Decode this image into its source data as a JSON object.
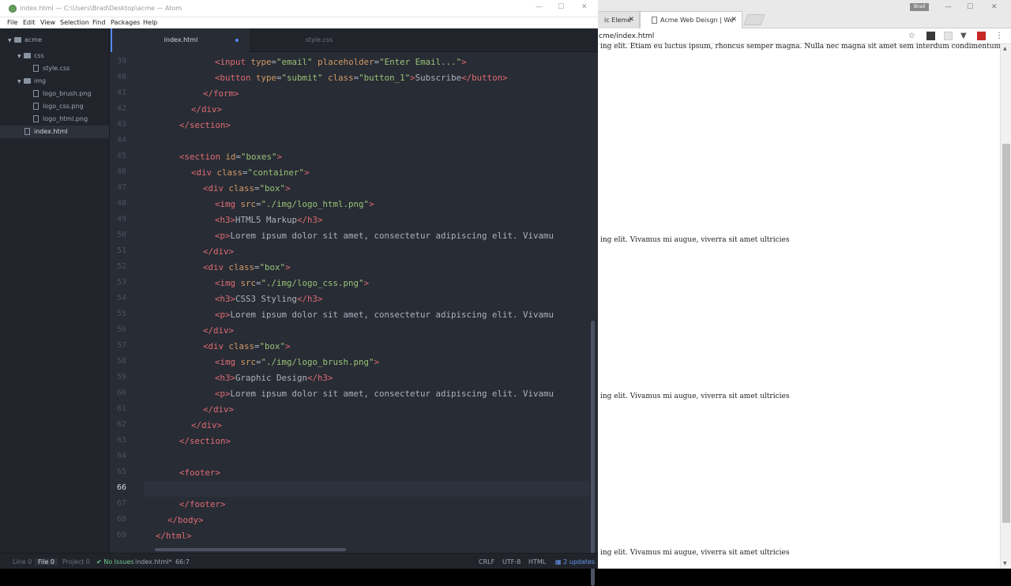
{
  "atom": {
    "window_title": "index.html — C:\\Users\\Brad\\Desktop\\acme — Atom",
    "menu": [
      "File",
      "Edit",
      "View",
      "Selection",
      "Find",
      "Packages",
      "Help"
    ],
    "tree": {
      "root": "acme",
      "css_folder": "css",
      "css_files": [
        "style.css"
      ],
      "img_folder": "img",
      "img_files": [
        "logo_brush.png",
        "logo_css.png",
        "logo_html.png"
      ],
      "root_file": "index.html"
    },
    "tabs": [
      {
        "label": "index.html",
        "modified": true
      },
      {
        "label": "style.css",
        "modified": false
      }
    ],
    "cursor_line": 66,
    "lines": [
      {
        "n": 39,
        "i": 6,
        "c": [
          [
            "t",
            "<input"
          ],
          [
            "a",
            " type"
          ],
          [
            "p",
            "="
          ],
          [
            "s",
            "\"email\""
          ],
          [
            "a",
            " placeholder"
          ],
          [
            "p",
            "="
          ],
          [
            "s",
            "\"Enter Email...\""
          ],
          [
            "t",
            ">"
          ]
        ]
      },
      {
        "n": 40,
        "i": 6,
        "c": [
          [
            "t",
            "<button"
          ],
          [
            "a",
            " type"
          ],
          [
            "p",
            "="
          ],
          [
            "s",
            "\"submit\""
          ],
          [
            "a",
            " class"
          ],
          [
            "p",
            "="
          ],
          [
            "s",
            "\"button_1\""
          ],
          [
            "t",
            ">"
          ],
          [
            "x",
            "Subscribe"
          ],
          [
            "t",
            "</button>"
          ]
        ]
      },
      {
        "n": 41,
        "i": 5,
        "c": [
          [
            "t",
            "</form>"
          ]
        ]
      },
      {
        "n": 42,
        "i": 4,
        "c": [
          [
            "t",
            "</div>"
          ]
        ]
      },
      {
        "n": 43,
        "i": 3,
        "c": [
          [
            "t",
            "</section>"
          ]
        ]
      },
      {
        "n": 44,
        "i": 0,
        "c": []
      },
      {
        "n": 45,
        "i": 3,
        "c": [
          [
            "t",
            "<section"
          ],
          [
            "a",
            " id"
          ],
          [
            "p",
            "="
          ],
          [
            "s",
            "\"boxes\""
          ],
          [
            "t",
            ">"
          ]
        ]
      },
      {
        "n": 46,
        "i": 4,
        "c": [
          [
            "t",
            "<div"
          ],
          [
            "a",
            " class"
          ],
          [
            "p",
            "="
          ],
          [
            "s",
            "\"container\""
          ],
          [
            "t",
            ">"
          ]
        ]
      },
      {
        "n": 47,
        "i": 5,
        "c": [
          [
            "t",
            "<div"
          ],
          [
            "a",
            " class"
          ],
          [
            "p",
            "="
          ],
          [
            "s",
            "\"box\""
          ],
          [
            "t",
            ">"
          ]
        ]
      },
      {
        "n": 48,
        "i": 6,
        "c": [
          [
            "t",
            "<img"
          ],
          [
            "a",
            " src"
          ],
          [
            "p",
            "="
          ],
          [
            "s",
            "\"./img/logo_html.png\""
          ],
          [
            "t",
            ">"
          ]
        ]
      },
      {
        "n": 49,
        "i": 6,
        "c": [
          [
            "t",
            "<h3>"
          ],
          [
            "x",
            "HTML5 Markup"
          ],
          [
            "t",
            "</h3>"
          ]
        ]
      },
      {
        "n": 50,
        "i": 6,
        "c": [
          [
            "t",
            "<p>"
          ],
          [
            "x",
            "Lorem ipsum dolor sit amet, consectetur adipiscing elit. Vivamu"
          ]
        ]
      },
      {
        "n": 51,
        "i": 5,
        "c": [
          [
            "t",
            "</div>"
          ]
        ]
      },
      {
        "n": 52,
        "i": 5,
        "c": [
          [
            "t",
            "<div"
          ],
          [
            "a",
            " class"
          ],
          [
            "p",
            "="
          ],
          [
            "s",
            "\"box\""
          ],
          [
            "t",
            ">"
          ]
        ]
      },
      {
        "n": 53,
        "i": 6,
        "c": [
          [
            "t",
            "<img"
          ],
          [
            "a",
            " src"
          ],
          [
            "p",
            "="
          ],
          [
            "s",
            "\"./img/logo_css.png\""
          ],
          [
            "t",
            ">"
          ]
        ]
      },
      {
        "n": 54,
        "i": 6,
        "c": [
          [
            "t",
            "<h3>"
          ],
          [
            "x",
            "CSS3 Styling"
          ],
          [
            "t",
            "</h3>"
          ]
        ]
      },
      {
        "n": 55,
        "i": 6,
        "c": [
          [
            "t",
            "<p>"
          ],
          [
            "x",
            "Lorem ipsum dolor sit amet, consectetur adipiscing elit. Vivamu"
          ]
        ]
      },
      {
        "n": 56,
        "i": 5,
        "c": [
          [
            "t",
            "</div>"
          ]
        ]
      },
      {
        "n": 57,
        "i": 5,
        "c": [
          [
            "t",
            "<div"
          ],
          [
            "a",
            " class"
          ],
          [
            "p",
            "="
          ],
          [
            "s",
            "\"box\""
          ],
          [
            "t",
            ">"
          ]
        ]
      },
      {
        "n": 58,
        "i": 6,
        "c": [
          [
            "t",
            "<img"
          ],
          [
            "a",
            " src"
          ],
          [
            "p",
            "="
          ],
          [
            "s",
            "\"./img/logo_brush.png\""
          ],
          [
            "t",
            ">"
          ]
        ]
      },
      {
        "n": 59,
        "i": 6,
        "c": [
          [
            "t",
            "<h3>"
          ],
          [
            "x",
            "Graphic Design"
          ],
          [
            "t",
            "</h3>"
          ]
        ]
      },
      {
        "n": 60,
        "i": 6,
        "c": [
          [
            "t",
            "<p>"
          ],
          [
            "x",
            "Lorem ipsum dolor sit amet, consectetur adipiscing elit. Vivamu"
          ]
        ]
      },
      {
        "n": 61,
        "i": 5,
        "c": [
          [
            "t",
            "</div>"
          ]
        ]
      },
      {
        "n": 62,
        "i": 4,
        "c": [
          [
            "t",
            "</div>"
          ]
        ]
      },
      {
        "n": 63,
        "i": 3,
        "c": [
          [
            "t",
            "</section>"
          ]
        ]
      },
      {
        "n": 64,
        "i": 0,
        "c": []
      },
      {
        "n": 65,
        "i": 3,
        "c": [
          [
            "t",
            "<footer>"
          ]
        ]
      },
      {
        "n": 66,
        "i": 0,
        "c": []
      },
      {
        "n": 67,
        "i": 3,
        "c": [
          [
            "t",
            "</footer>"
          ]
        ]
      },
      {
        "n": 68,
        "i": 2,
        "c": [
          [
            "t",
            "</body>"
          ]
        ]
      },
      {
        "n": 69,
        "i": 1,
        "c": [
          [
            "t",
            "</html>"
          ]
        ]
      }
    ],
    "status": {
      "line": "Line 0",
      "file": "File 0",
      "project": "Project 0",
      "issues": "No Issues",
      "filename": "index.html*",
      "cursor": "66:7",
      "line_ending": "CRLF",
      "encoding": "UTF-8",
      "grammar": "HTML",
      "updates": "2 updates"
    }
  },
  "browser": {
    "tabs": [
      {
        "label": "ic Eleme"
      },
      {
        "label": "Acme Web Deisgn | We"
      }
    ],
    "user_badge": "Brad",
    "url": "cme/index.html",
    "paragraphs": [
      "ing elit. Etiam eu luctus ipsum, rhoncus semper magna. Nulla nec magna sit amet sem interdum condimentum.",
      "ing elit. Vivamus mi augue, viverra sit amet ultricies",
      "ing elit. Vivamus mi augue, viverra sit amet ultricies",
      "ing elit. Vivamus mi augue, viverra sit amet ultricies"
    ]
  }
}
